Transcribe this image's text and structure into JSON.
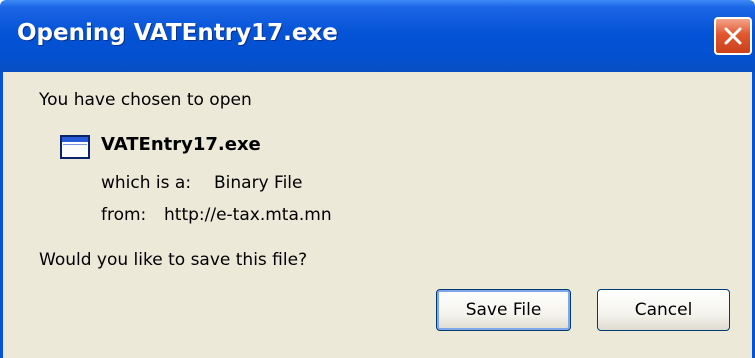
{
  "dialog": {
    "title": "Opening VATEntry17.exe",
    "intro": "You have chosen to open",
    "file_name": "VATEntry17.exe",
    "type_label": "which is a:",
    "type_value": "Binary File",
    "from_label": "from:",
    "from_value": "http://e-tax.mta.mn",
    "question": "Would you like to save this file?"
  },
  "buttons": {
    "save_label": "Save File",
    "cancel_label": "Cancel"
  },
  "icons": {
    "close": "close-icon",
    "file": "application-window-icon"
  },
  "colors": {
    "titlebar": "#0553d6",
    "dialog_background": "#ece9d8",
    "close_button": "#e2572f"
  }
}
